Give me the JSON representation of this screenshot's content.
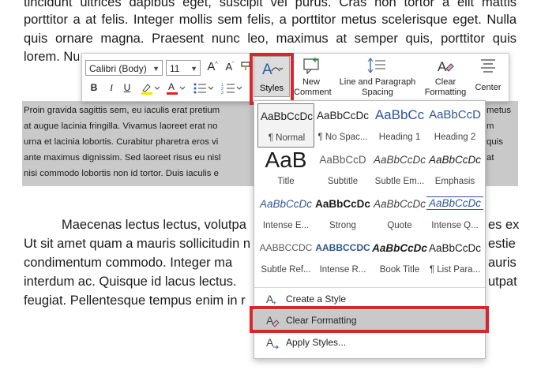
{
  "document": {
    "top_lines": [
      "tincidunt ultrices dapibus eget, suscipit vel purus. Cras non tortor a elit mattis",
      "porttitor a at felis. Integer mollis sem felis, a porttitor metus scelerisque eget. Nulla",
      "quis ornare magna. Praesent nunc leo, maximus at semper quis, porttitor quis",
      "lorem. Nu"
    ],
    "selected_lines": [
      "Proin gravida sagittis sem, eu iaculis erat pretium",
      "at augue lacinia fringilla. Vivamus laoreet erat no",
      "urna et lacinia lobortis. Curabitur pharetra eros vi",
      "ante maximus dignissim. Sed laoreet risus eu nisl",
      "nisi commodo lobortis non id tortor. Duis iaculis e"
    ],
    "selected_tails": [
      "metus",
      "m",
      "quis",
      "at"
    ],
    "bottom_lines": [
      "Maecenas lectus lectus, volutpa",
      "Ut sit amet quam a mauris sollicitudin n",
      "condimentum commodo. Integer ma",
      "interdum ac. Quisque id lacus lectus.",
      "feugiat. Pellentesque tempus enim in r"
    ],
    "bottom_tails": [
      "es ex.",
      "estie",
      "auris",
      "utpat",
      ""
    ]
  },
  "toolbar": {
    "font_name": "Calibri (Body)",
    "font_size": "11",
    "bold": "B",
    "italic": "I",
    "underline": "U",
    "grow_font": "A",
    "shrink_font": "A",
    "styles_label": "Styles",
    "new_comment_label": "New Comment",
    "line_spacing_label": "Line and Paragraph Spacing",
    "clear_formatting_label": "Clear Formatting",
    "center_label": "Center"
  },
  "gallery": {
    "tiles": [
      {
        "sample": "AaBbCcDc",
        "name": "¶ Normal"
      },
      {
        "sample": "AaBbCcDc",
        "name": "¶ No Spac..."
      },
      {
        "sample": "AaBbCc",
        "name": "Heading 1"
      },
      {
        "sample": "AaBbCcD",
        "name": "Heading 2"
      },
      {
        "sample": "AaB",
        "name": "Title"
      },
      {
        "sample": "AaBbCcD",
        "name": "Subtitle"
      },
      {
        "sample": "AaBbCcDc",
        "name": "Subtle Em..."
      },
      {
        "sample": "AaBbCcDc",
        "name": "Emphasis"
      },
      {
        "sample": "AaBbCcDc",
        "name": "Intense E..."
      },
      {
        "sample": "AaBbCcDc",
        "name": "Strong"
      },
      {
        "sample": "AaBbCcDc",
        "name": "Quote"
      },
      {
        "sample": "AaBbCcDc",
        "name": "Intense Q..."
      },
      {
        "sample": "AABBCCDC",
        "name": "Subtle Ref..."
      },
      {
        "sample": "AABBCCDC",
        "name": "Intense R..."
      },
      {
        "sample": "AaBbCcDc",
        "name": "Book Title"
      },
      {
        "sample": "AaBbCcDc",
        "name": "¶ List Para..."
      }
    ],
    "menu": [
      {
        "label": "Create a Style"
      },
      {
        "label": "Clear Formatting"
      },
      {
        "label": "Apply Styles..."
      }
    ]
  },
  "colors": {
    "highlight_red": "#d8262c",
    "selection_gray": "#c9c9c9",
    "heading_blue": "#2f5496",
    "highlighter_yellow": "#f5e500",
    "font_color_red": "#e0241b"
  }
}
